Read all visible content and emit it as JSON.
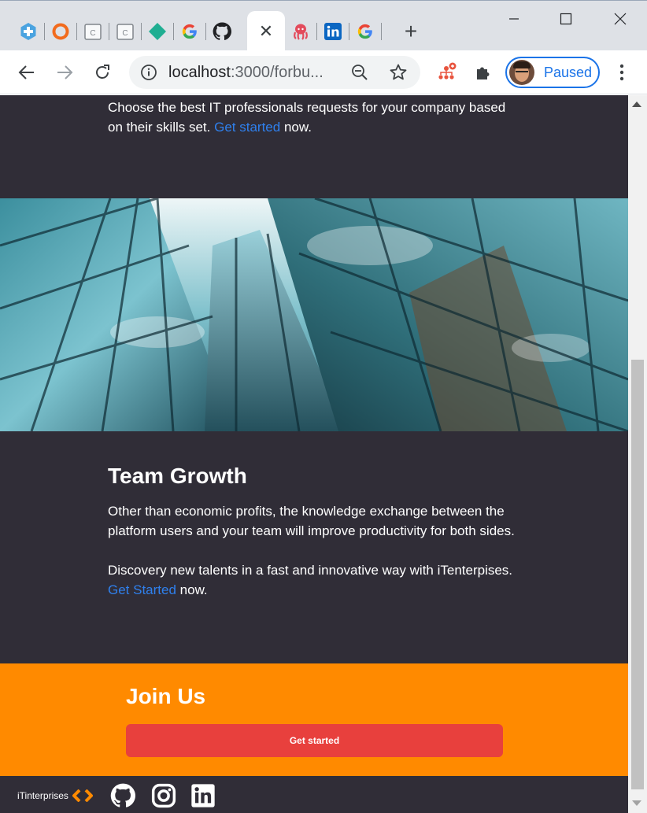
{
  "browser": {
    "tabs": [
      {
        "icon": "medical-cross-icon"
      },
      {
        "icon": "ring-icon"
      },
      {
        "icon": "calendar-c-icon"
      },
      {
        "icon": "calendar-c-icon"
      },
      {
        "icon": "diamond-icon"
      },
      {
        "icon": "google-icon"
      },
      {
        "icon": "github-icon"
      },
      {
        "icon": "close-icon",
        "active": true
      },
      {
        "icon": "octopus-icon"
      },
      {
        "icon": "linkedin-icon"
      },
      {
        "icon": "google-icon"
      }
    ],
    "new_tab_label": "+",
    "active_tab_close": "✕",
    "url_host": "localhost",
    "url_path": ":3000/forbu...",
    "profile_label": "Paused"
  },
  "page": {
    "intro": {
      "text_before": "Choose the best IT professionals requests for your company based on their skills set. ",
      "link": "Get started",
      "text_after": " now."
    },
    "growth": {
      "title": "Team Growth",
      "paragraph1": "Other than economic profits, the knowledge exchange between the platform users and your team will improve productivity for both sides.",
      "paragraph2": "Discovery new talents in a fast and innovative way with iTenterpises.",
      "link": "Get Started",
      "text_after": " now."
    },
    "join": {
      "title": "Join Us",
      "button": "Get started"
    },
    "footer": {
      "brand": "iTinterprises",
      "social": [
        "github-icon",
        "instagram-icon",
        "linkedin-icon"
      ]
    }
  },
  "colors": {
    "page_bg": "#302d37",
    "link": "#2f80ed",
    "join_bg": "#ff8a00",
    "button": "#e8403d"
  }
}
